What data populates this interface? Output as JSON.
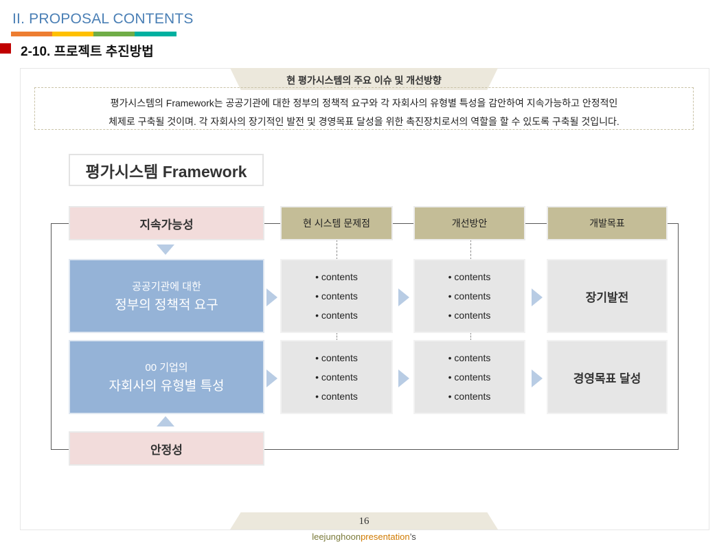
{
  "header": {
    "section_title": "II. PROPOSAL CONTENTS",
    "subtitle": "2-10. 프로젝트 추진방법",
    "stripe_colors": [
      "#ed7d31",
      "#ffc000",
      "#70ad47",
      "#00b0a0"
    ]
  },
  "intro": {
    "tab_label": "현 평가시스템의 주요 이슈 및 개선방향",
    "line1": "평가시스템의 Framework는 공공기관에 대한 정부의 정책적 요구와 각 자회사의 유형별 특성을 감안하여 지속가능하고 안정적인",
    "line2": "체제로 구축될 것이며. 각 자회사의 장기적인 발전 및 경영목표 달성을 위한 촉진장치로서의 역할을 할 수 있도록 구축될 것입니다."
  },
  "framework": {
    "title": "평가시스템 Framework",
    "top_label": "지속가능성",
    "bottom_label": "안정성",
    "columns": [
      "현 시스템 문제점",
      "개선방안",
      "개발목표"
    ],
    "rows": [
      {
        "small": "공공기관에 대한",
        "big": "정부의 정책적 요구",
        "problems": [
          "contents",
          "contents",
          "contents"
        ],
        "improvements": [
          "contents",
          "contents",
          "contents"
        ],
        "goal": "장기발전"
      },
      {
        "small": "00 기업의",
        "big": "자회사의 유형별 특성",
        "problems": [
          "contents",
          "contents",
          "contents"
        ],
        "improvements": [
          "contents",
          "contents",
          "contents"
        ],
        "goal": "경영목표 달성"
      }
    ]
  },
  "footer": {
    "page_number": "16",
    "brand_part1": "leejunghoon",
    "brand_part2": "presentation",
    "brand_part3": "’s"
  },
  "colors": {
    "accent_blue": "#4a7fb5",
    "marker_red": "#c00000",
    "pink_box": "#f2dcdb",
    "tan_box": "#c4bd97",
    "blue_box": "#95b3d7",
    "grey_box": "#e6e6e6"
  }
}
